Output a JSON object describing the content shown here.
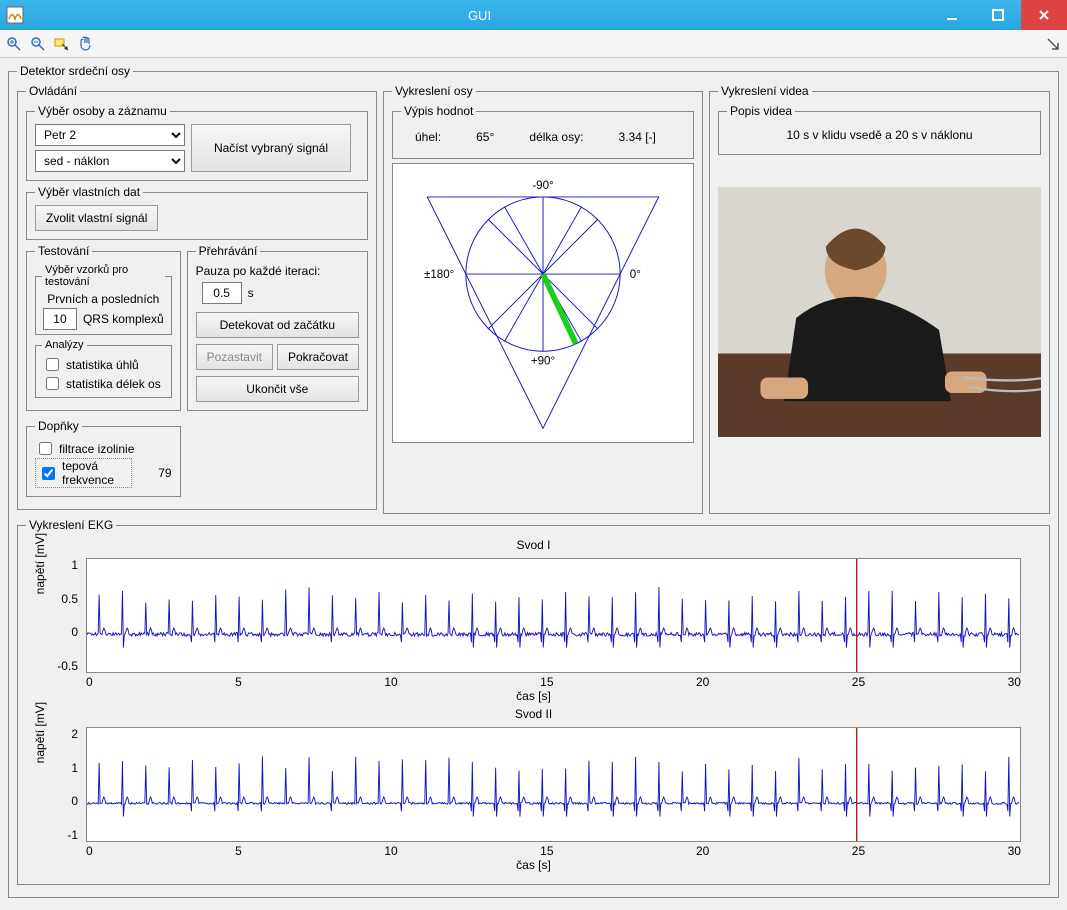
{
  "window": {
    "title": "GUI"
  },
  "toolbar": {
    "zoom_in": "zoom-in",
    "zoom_out": "zoom-out",
    "data_cursor": "data-cursor",
    "pan": "pan"
  },
  "detector_title": "Detektor srdeční osy",
  "ovladani": {
    "title": "Ovládání",
    "vyber_osoby": {
      "title": "Výběr osoby a záznamu",
      "person_selected": "Petr 2",
      "record_selected": "sed - náklon",
      "load_btn": "Načíst vybraný signál"
    },
    "vyber_vlastnich": {
      "title": "Výběr vlastních dat",
      "choose_btn": "Zvolit vlastní signál"
    },
    "testovani": {
      "title": "Testování",
      "vzorky_title": "Výběr vzorků pro testování",
      "line1": "Prvních a posledních",
      "qrs_count": "10",
      "qrs_label": "QRS komplexů",
      "analyzy_title": "Analýzy",
      "stat_uhlu": "statistika úhlů",
      "stat_delek": "statistika délek os"
    },
    "doplnky": {
      "title": "Dopňky",
      "filtr": "filtrace izolinie",
      "tep": "tepová frekvence",
      "tep_val": "79"
    },
    "prehravani": {
      "title": "Přehrávání",
      "pause_label": "Pauza po každé iteraci:",
      "pause_val": "0.5",
      "pause_unit": "s",
      "detekovat": "Detekovat od začátku",
      "pozastavit": "Pozastavit",
      "pokracovat": "Pokračovat",
      "ukoncit": "Ukončit vše"
    }
  },
  "vykresleni_osy": {
    "title": "Vykreslení osy",
    "vypis_title": "Výpis hodnot",
    "uhel_label": "úhel:",
    "uhel_val": "65°",
    "delka_label": "délka osy:",
    "delka_val": "3.34 [-]",
    "labels": {
      "top": "-90°",
      "right": "0°",
      "bottom": "+90°",
      "left": "±180°"
    }
  },
  "vykresleni_videa": {
    "title": "Vykreslení videa",
    "popis_title": "Popis videa",
    "popis_text": "10 s v klidu vsedě a 20 s v náklonu"
  },
  "ekg": {
    "title": "Vykreslení EKG",
    "svod1_title": "Svod I",
    "svod2_title": "Svod II",
    "ylabel": "napětí [mV]",
    "xlabel": "čas [s]",
    "xticks": [
      "0",
      "5",
      "10",
      "15",
      "20",
      "25",
      "30"
    ],
    "yticks1": [
      "1",
      "0.5",
      "0",
      "-0.5"
    ],
    "yticks2": [
      "2",
      "1",
      "0",
      "-1"
    ],
    "cursor_x_frac": 0.825
  },
  "chart_data": [
    {
      "type": "line",
      "title": "Svod I",
      "xlabel": "čas [s]",
      "ylabel": "napětí [mV]",
      "xlim": [
        0,
        30
      ],
      "ylim": [
        -0.5,
        1
      ],
      "note": "ECG waveform with periodic QRS spikes ~0.5–0.8 mV amplitude, baseline ~0 mV, ~40 beats visible over 30 s; vertical red cursor at ~24.8 s"
    },
    {
      "type": "line",
      "title": "Svod II",
      "xlabel": "čas [s]",
      "ylabel": "napětí [mV]",
      "xlim": [
        0,
        30
      ],
      "ylim": [
        -1,
        2
      ],
      "note": "ECG waveform with periodic QRS spikes ~1–1.5 mV amplitude, baseline ~0 mV; vertical red cursor at ~24.8 s"
    },
    {
      "type": "polar-indicator",
      "title": "Srdeční osa",
      "angle_deg": 65,
      "magnitude": 3.34,
      "angle_labels": {
        "top": "-90°",
        "right": "0°",
        "bottom": "+90°",
        "left": "±180°"
      }
    }
  ]
}
